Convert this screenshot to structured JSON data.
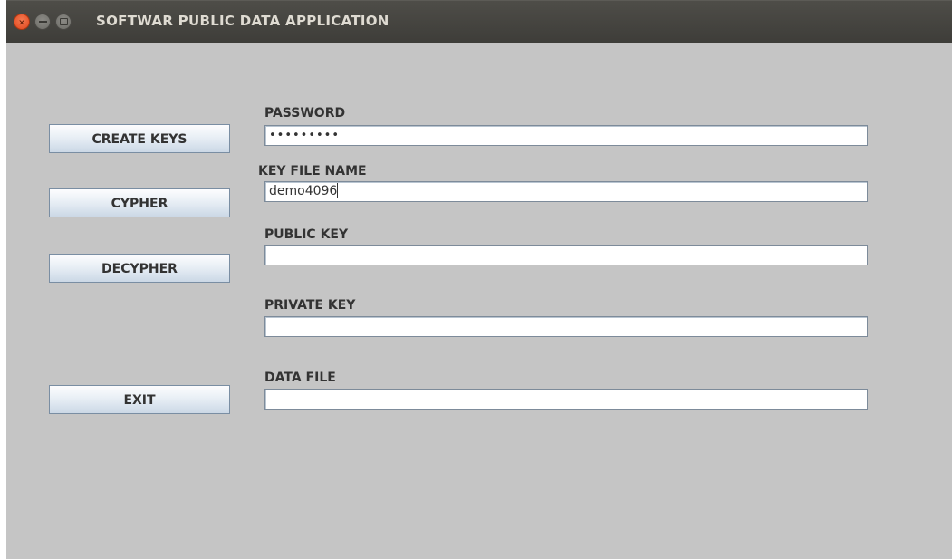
{
  "window": {
    "title": "SOFTWAR PUBLIC DATA APPLICATION",
    "controls": {
      "close_icon": "close-icon",
      "minimize_icon": "minimize-icon",
      "maximize_icon": "maximize-icon"
    }
  },
  "buttons": {
    "create_keys": "CREATE KEYS",
    "cypher": "CYPHER",
    "decypher": "DECYPHER",
    "exit": "EXIT"
  },
  "fields": {
    "password": {
      "label": "PASSWORD",
      "value": "•••••••••"
    },
    "key_file_name": {
      "label": "KEY FILE NAME",
      "value": "demo4096"
    },
    "public_key": {
      "label": "PUBLIC KEY",
      "value": ""
    },
    "private_key": {
      "label": "PRIVATE KEY",
      "value": ""
    },
    "data_file": {
      "label": "DATA FILE",
      "value": ""
    }
  },
  "colors": {
    "window_bg": "#c5c5c5",
    "titlebar_bg": "#403f3b",
    "close_button": "#e8542a"
  }
}
